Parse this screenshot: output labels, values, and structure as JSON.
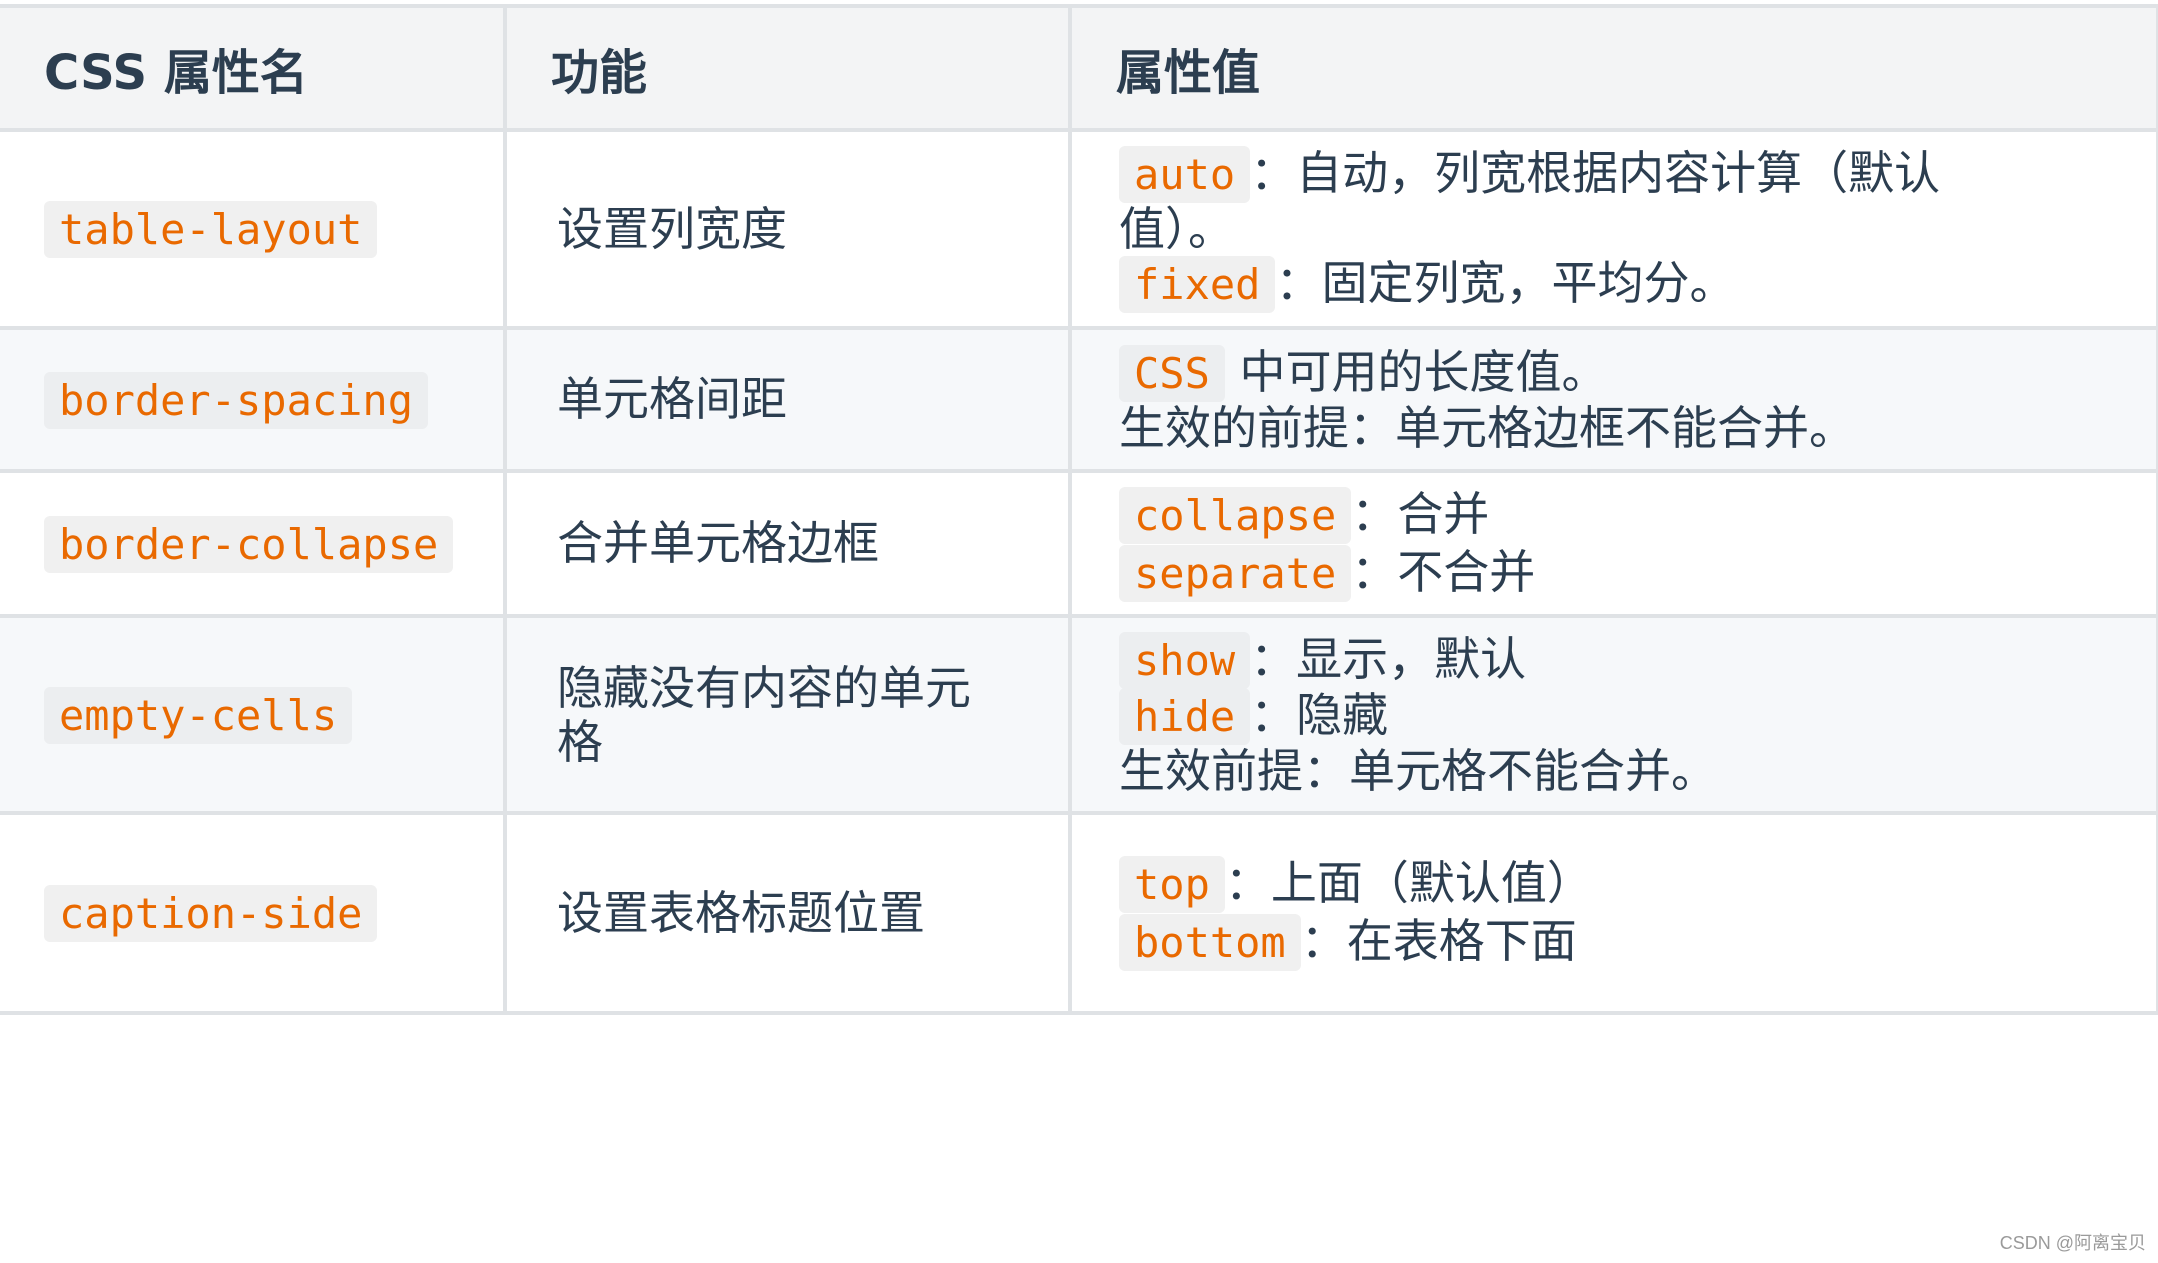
{
  "headers": [
    "CSS 属性名",
    "功能",
    "属性值"
  ],
  "rows": [
    {
      "name": "table-layout",
      "function": "设置列宽度",
      "values": [
        {
          "code": "auto",
          "text": "：自动，列宽根据内容计算（默认"
        },
        {
          "code": "",
          "text": "值）。"
        },
        {
          "code": "fixed",
          "text": "：固定列宽，平均分。"
        }
      ]
    },
    {
      "name": "border-spacing",
      "function": "单元格间距",
      "values": [
        {
          "code": "CSS",
          "text": " 中可用的长度值。"
        },
        {
          "code": "",
          "text": "生效的前提：单元格边框不能合并。"
        }
      ]
    },
    {
      "name": "border-collapse",
      "function": "合并单元格边框",
      "values": [
        {
          "code": "collapse",
          "text": "：合并"
        },
        {
          "code": "separate",
          "text": "：不合并"
        }
      ]
    },
    {
      "name": "empty-cells",
      "function": [
        "隐藏没有内容的单元",
        "格"
      ],
      "values": [
        {
          "code": "show",
          "text": "：显示，默认"
        },
        {
          "code": "hide",
          "text": "：隐藏"
        },
        {
          "code": "",
          "text": "生效前提：单元格不能合并。"
        }
      ]
    },
    {
      "name": "caption-side",
      "function": "设置表格标题位置",
      "values": [
        {
          "code": "top",
          "text": "：上面（默认值）"
        },
        {
          "code": "bottom",
          "text": "：在表格下面"
        }
      ]
    }
  ],
  "watermark": "CSDN @阿离宝贝"
}
